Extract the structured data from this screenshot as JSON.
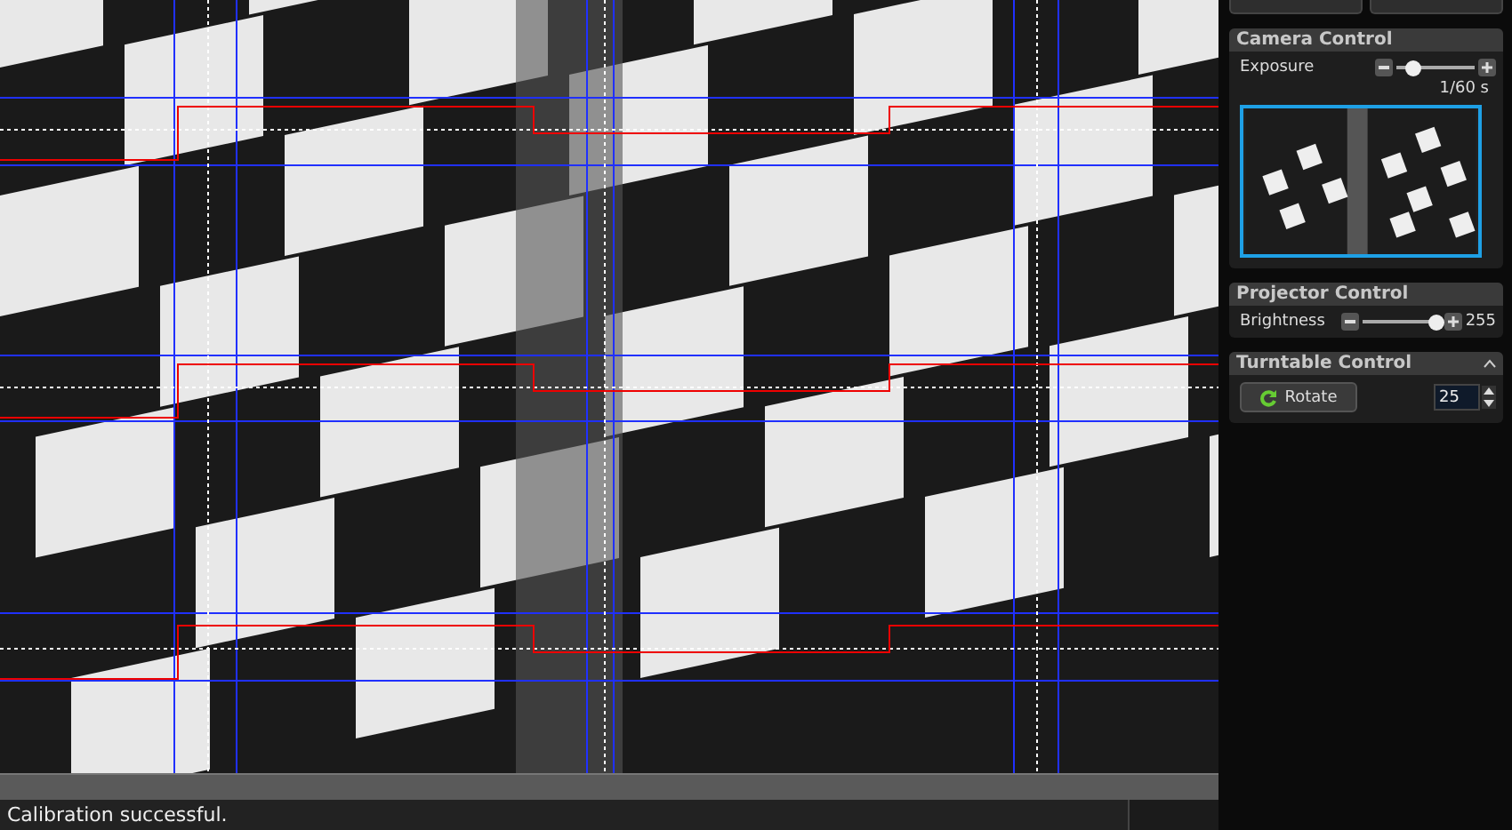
{
  "camera_control": {
    "title": "Camera Control",
    "exposure": {
      "label": "Exposure",
      "level": 0.2,
      "reading": "1/60 s"
    }
  },
  "projector_control": {
    "title": "Projector Control",
    "brightness": {
      "label": "Brightness",
      "level": 0.93,
      "reading": "255"
    }
  },
  "turntable_control": {
    "title": "Turntable Control",
    "expanded": true,
    "rotate_button": "Rotate",
    "steps": "25"
  },
  "status_bar": {
    "message": "Calibration successful."
  }
}
